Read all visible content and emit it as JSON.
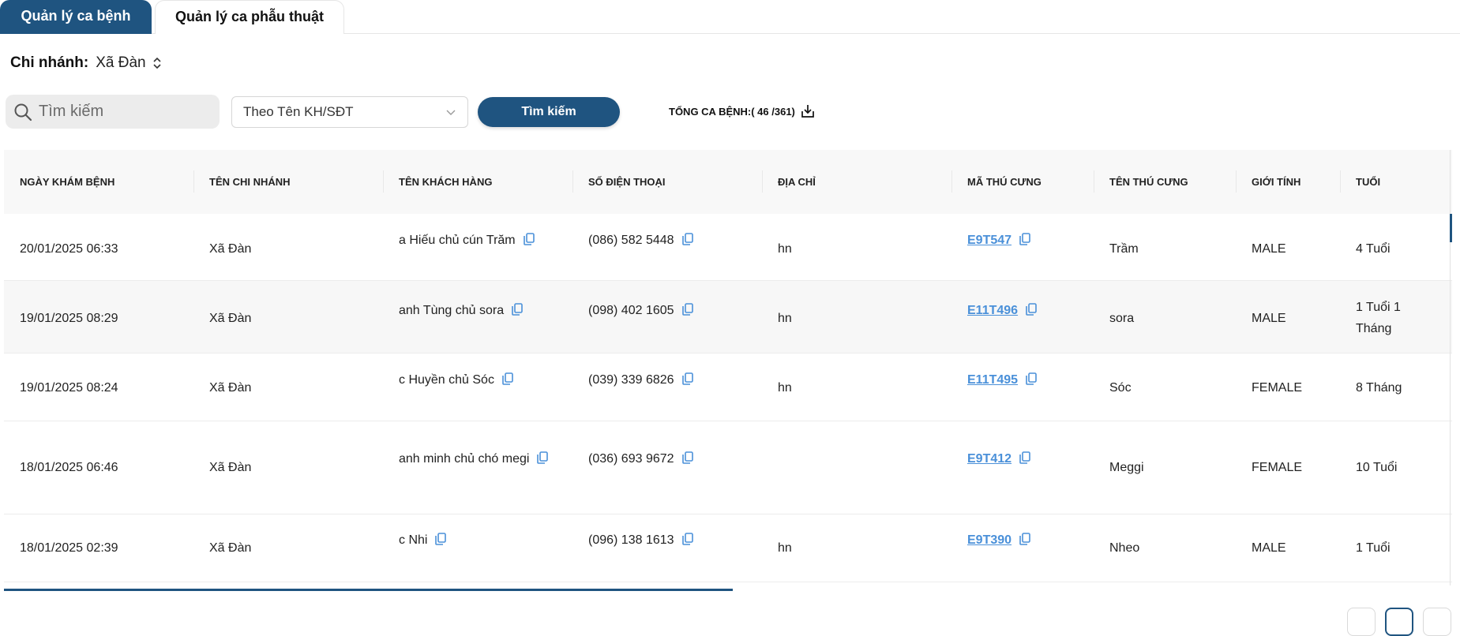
{
  "tabs": [
    {
      "label": "Quản lý ca bệnh",
      "active": true
    },
    {
      "label": "Quản lý ca phẫu thuật",
      "active": false
    }
  ],
  "branch": {
    "label": "Chi nhánh:",
    "value": "Xã Đàn"
  },
  "search": {
    "placeholder": "Tìm kiếm",
    "value": ""
  },
  "filter": {
    "selected": "Theo Tên KH/SĐT"
  },
  "search_button": "Tìm kiếm",
  "total": {
    "text": "TỔNG CA BỆNH:( 46 /361)"
  },
  "table": {
    "headers": [
      "NGÀY KHÁM BỆNH",
      "TÊN CHI NHÁNH",
      "TÊN KHÁCH HÀNG",
      "SỐ ĐIỆN THOẠI",
      "ĐỊA CHỈ",
      "MÃ THÚ CƯNG",
      "TÊN THÚ CƯNG",
      "GIỚI TÍNH",
      "TUỔI"
    ],
    "rows": [
      {
        "date": "20/01/2025 06:33",
        "branch": "Xã Đàn",
        "customer": "a Hiếu chủ cún Trăm",
        "phone": "(086) 582 5448",
        "address": "hn",
        "pet_code": "E9T547",
        "pet_name": "Trầm",
        "gender": "MALE",
        "age": "4 Tuổi"
      },
      {
        "date": "19/01/2025 08:29",
        "branch": "Xã Đàn",
        "customer": "anh Tùng chủ sora",
        "phone": "(098) 402 1605",
        "address": "hn",
        "pet_code": "E11T496",
        "pet_name": "sora",
        "gender": "MALE",
        "age": "1 Tuổi 1 Tháng"
      },
      {
        "date": "19/01/2025 08:24",
        "branch": "Xã Đàn",
        "customer": "c Huyền chủ Sóc",
        "phone": "(039) 339 6826",
        "address": "hn",
        "pet_code": "E11T495",
        "pet_name": "Sóc",
        "gender": "FEMALE",
        "age": "8 Tháng"
      },
      {
        "date": "18/01/2025 06:46",
        "branch": "Xã Đàn",
        "customer": "anh minh chủ chó megi",
        "phone": "(036) 693 9672",
        "address": "",
        "pet_code": "E9T412",
        "pet_name": "Meggi",
        "gender": "FEMALE",
        "age": "10 Tuổi"
      },
      {
        "date": "18/01/2025 02:39",
        "branch": "Xã Đàn",
        "customer": "c Nhi",
        "phone": "(096) 138 1613",
        "address": "hn",
        "pet_code": "E9T390",
        "pet_name": "Nheo",
        "gender": "MALE",
        "age": "1 Tuổi"
      }
    ]
  },
  "icons": {
    "search": "search-icon",
    "sort": "sort-updown-icon",
    "chevron": "chevron-down-icon",
    "download": "download-icon",
    "copy": "copy-icon"
  },
  "colors": {
    "primary": "#1f5480",
    "link": "#4a90d9"
  }
}
